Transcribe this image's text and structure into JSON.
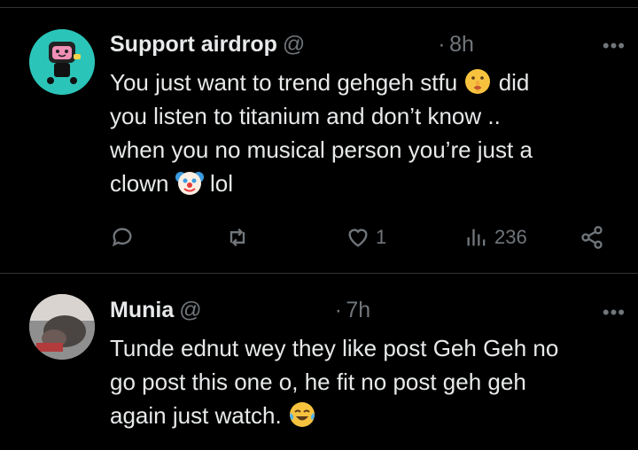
{
  "tweets": [
    {
      "name": "Support airdrop",
      "handle": "@",
      "dot": "·",
      "time": "8h",
      "lines": [
        "You just want to trend gehgeh stfu",
        "did",
        "you listen to titanium and don’t know ..",
        "when you no musical person you’re just a",
        "clown",
        "lol"
      ],
      "emojis": [
        "shushing-face-emoji",
        "clown-face-emoji"
      ],
      "actions": {
        "reply_count": "",
        "retweet_count": "",
        "like_count": "1",
        "view_count": "236"
      },
      "more": "•••"
    },
    {
      "name": "Munia",
      "handle": "@",
      "dot": "·",
      "time": "7h",
      "lines": [
        "Tunde ednut wey they like post Geh Geh no",
        "go post this one o, he fit no post geh geh",
        "again just watch."
      ],
      "emojis": [
        "tears-of-joy-emoji"
      ],
      "more": "•••"
    }
  ],
  "colors": {
    "background": "#000000",
    "text": "#e7e9ea",
    "secondary": "#71767b",
    "divider": "#2f3336",
    "avatar1_bg": "#2bc4b8"
  }
}
